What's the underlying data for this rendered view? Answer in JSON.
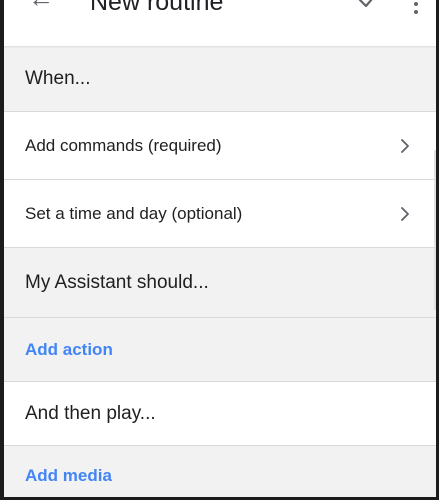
{
  "toolbar": {
    "title": "New routine",
    "back_icon": "arrow-back-icon",
    "save_icon": "check-icon",
    "more_icon": "more-vert-icon"
  },
  "sections": {
    "when_header": "When...",
    "add_commands": "Add commands (required)",
    "set_time": "Set a time and day (optional)",
    "assistant_header": "My Assistant should...",
    "add_action": "Add action",
    "then_play_header": "And then play...",
    "add_media": "Add media"
  },
  "colors": {
    "link": "#4285f4",
    "section_bg": "#f2f2f2",
    "divider": "#d9d9d9"
  }
}
